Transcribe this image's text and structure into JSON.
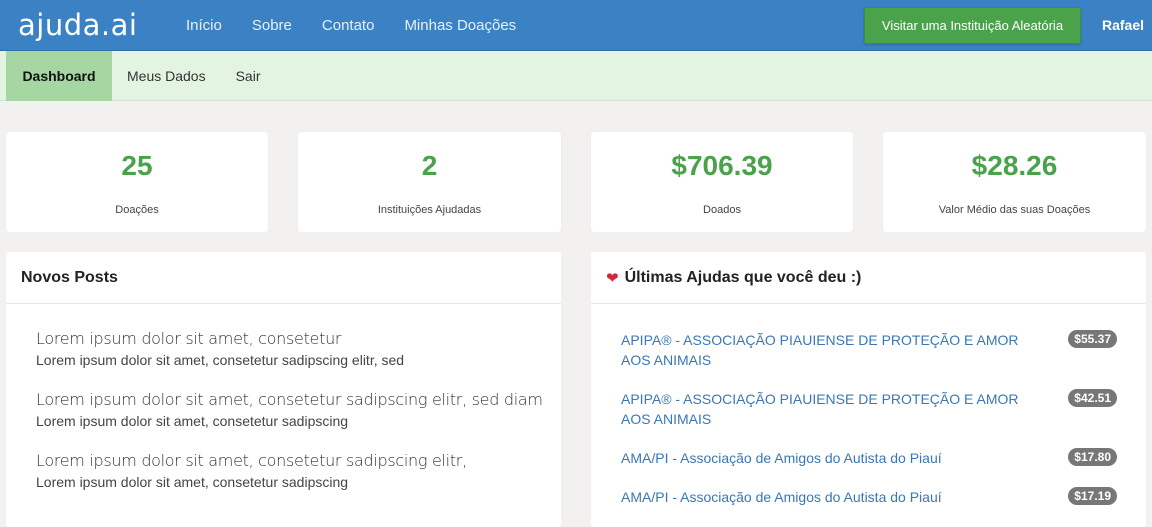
{
  "navbar": {
    "brand": "ajuda.ai",
    "links": [
      "Início",
      "Sobre",
      "Contato",
      "Minhas Doações"
    ],
    "visit_button": "Visitar uma Instituição Aleatória",
    "user": "Rafael"
  },
  "subnav": {
    "items": [
      "Dashboard",
      "Meus Dados",
      "Sair"
    ]
  },
  "stats": [
    {
      "value": "25",
      "label": "Doações"
    },
    {
      "value": "2",
      "label": "Instituições Ajudadas"
    },
    {
      "value": "$706.39",
      "label": "Doados"
    },
    {
      "value": "$28.26",
      "label": "Valor Médio das suas Doações"
    }
  ],
  "posts_panel": {
    "title": "Novos Posts",
    "posts": [
      {
        "title": "Lorem ipsum dolor sit amet, consetetur",
        "sub": "Lorem ipsum dolor sit amet, consetetur sadipscing elitr, sed"
      },
      {
        "title": "Lorem ipsum dolor sit amet, consetetur sadipscing elitr, sed diam",
        "sub": "Lorem ipsum dolor sit amet, consetetur sadipscing"
      },
      {
        "title": "Lorem ipsum dolor sit amet, consetetur sadipscing elitr,",
        "sub": "Lorem ipsum dolor sit amet, consetetur sadipscing"
      }
    ]
  },
  "help_panel": {
    "icon": "heart-icon",
    "title": "Últimas Ajudas que você deu :)",
    "items": [
      {
        "name": "APIPA® - ASSOCIAÇÃO PIAUIENSE DE PROTEÇÃO E AMOR AOS ANIMAIS",
        "amount": "$55.37"
      },
      {
        "name": "APIPA® - ASSOCIAÇÃO PIAUIENSE DE PROTEÇÃO E AMOR AOS ANIMAIS",
        "amount": "$42.51"
      },
      {
        "name": "AMA/PI - Associação de Amigos do Autista do Piauí",
        "amount": "$17.80"
      },
      {
        "name": "AMA/PI - Associação de Amigos do Autista do Piauí",
        "amount": "$17.19"
      }
    ]
  },
  "colors": {
    "navbar": "#3b82c4",
    "subnav": "#e3f5e2",
    "subnav_active": "#a6d7a3",
    "accent_green": "#4aa24a",
    "link_blue": "#3a77b5",
    "heart": "#d9253a"
  }
}
